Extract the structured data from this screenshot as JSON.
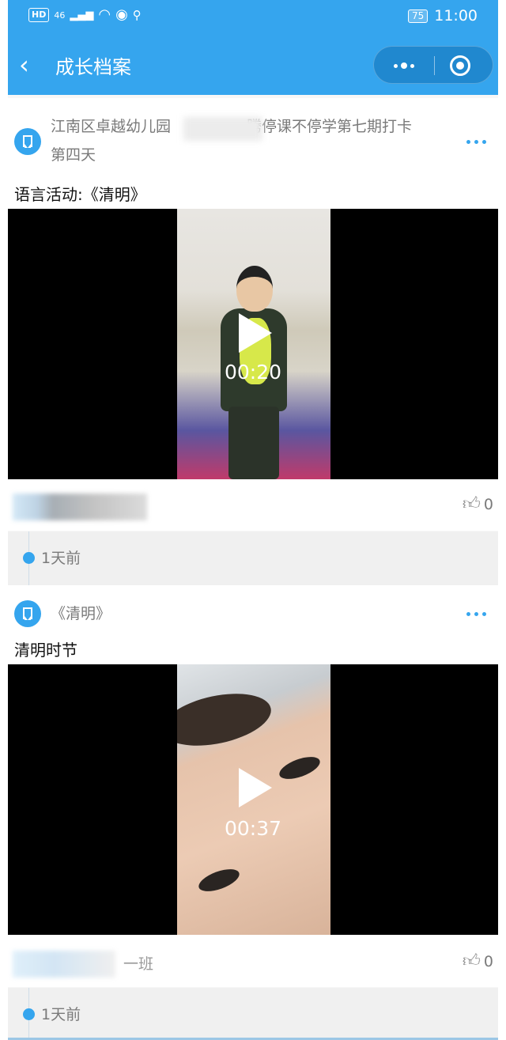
{
  "status_bar": {
    "hd_label": "HD",
    "network": "46",
    "battery": "75",
    "time": "11:00",
    "icons": [
      "signal-icon",
      "wifi-icon",
      "browser-icon",
      "location-icon",
      "battery-icon"
    ]
  },
  "nav": {
    "back_icon": "chevron-left-icon",
    "title": "成长档案",
    "more_icon": "more-dots-icon",
    "close_icon": "target-close-icon"
  },
  "posts": [
    {
      "source_prefix": "江南区卓越幼儿园",
      "source_suffix": "腾停课不停学第七期打卡",
      "source_line2": "第四天",
      "caption": "语言活动:《清明》",
      "duration": "00:20",
      "likes": "0",
      "time_ago": "1天前"
    },
    {
      "source": "《清明》",
      "caption": "清明时节",
      "duration": "00:37",
      "author_suffix": "一班",
      "likes": "0",
      "time_ago": "1天前"
    }
  ],
  "colors": {
    "primary": "#35a5ee",
    "capsule": "#2088cf",
    "text_secondary": "#7a7a7a"
  }
}
